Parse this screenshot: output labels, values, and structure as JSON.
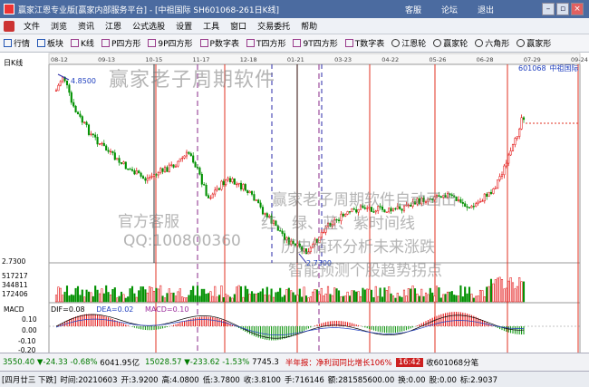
{
  "titlebar": {
    "title": "赢家江恩专业版[赢家内部服务平台] - [中祖国际  SH601068-261日K线]",
    "btn_service": "客服",
    "btn_forum": "论坛",
    "btn_exit": "退出"
  },
  "menu": [
    "文件",
    "浏览",
    "资讯",
    "江恩",
    "公式选股",
    "设置",
    "工具",
    "窗口",
    "交易委托",
    "帮助"
  ],
  "toolbar": [
    "行情",
    "板块",
    "K线",
    "P四方形",
    "9P四方形",
    "P数字表",
    "T四方形",
    "9T四方形",
    "T数字表",
    "江恩轮",
    "赢家轮",
    "六角形",
    "赢家形"
  ],
  "chart": {
    "period_label": "日K线",
    "stock_code": "601068",
    "stock_name": "中祖国际",
    "high_label": "4.8500",
    "low_label": "2.7300",
    "price_axis_low": "2.7300",
    "volume_axis": [
      "517217",
      "344811",
      "172406"
    ],
    "date_ticks": [
      "08-12",
      "09-13",
      "10-15",
      "11-17",
      "12-18",
      "01-21",
      "03-23",
      "04-22",
      "05-26",
      "06-28",
      "07-29",
      "09-24"
    ],
    "watermarks": {
      "main": "赢家老子周期软件",
      "service": "官方客服",
      "qq": "QQ:100800360",
      "l1": "赢家老子周期软件自动画出",
      "l2": "红、绿、蓝、紫时间线",
      "l3": "历史循环分析未来涨跌",
      "l4": "智能预测个股趋势拐点"
    }
  },
  "macd": {
    "title": "MACD",
    "dif": "DIF=0.08",
    "dea": "DEA=0.02",
    "macd": "MACD=0.10",
    "axis": [
      "0.10",
      "0.00",
      "-0.10",
      "-0.20"
    ]
  },
  "statusbar": {
    "sh_index": "3550.40",
    "sh_change": "▼-24.33",
    "sh_pct": "-0.68%",
    "sh_amount": "6041.95亿",
    "sz_index": "15028.57",
    "sz_change": "▼-233.62",
    "sz_pct": "-1.53%",
    "sz_amount": "7745.3",
    "ticker": "半年报：净利润同比增长106%",
    "time": "16:42",
    "fav": "收601068分笔"
  },
  "bottombar": [
    "[四月廿三  下跌]",
    "时间:20210603",
    "开:3.9200",
    "高:4.0800",
    "低:3.7800",
    "收:3.8100",
    "手:716146",
    "额:281585600.00",
    "换:0.00",
    "股:0.00",
    "标:2.9037"
  ],
  "colors": {
    "up": "#e00000",
    "down": "#009000",
    "time_line": "#e03020",
    "dash_line": "#2a2aa8",
    "purple_line": "#8a2a8a"
  }
}
